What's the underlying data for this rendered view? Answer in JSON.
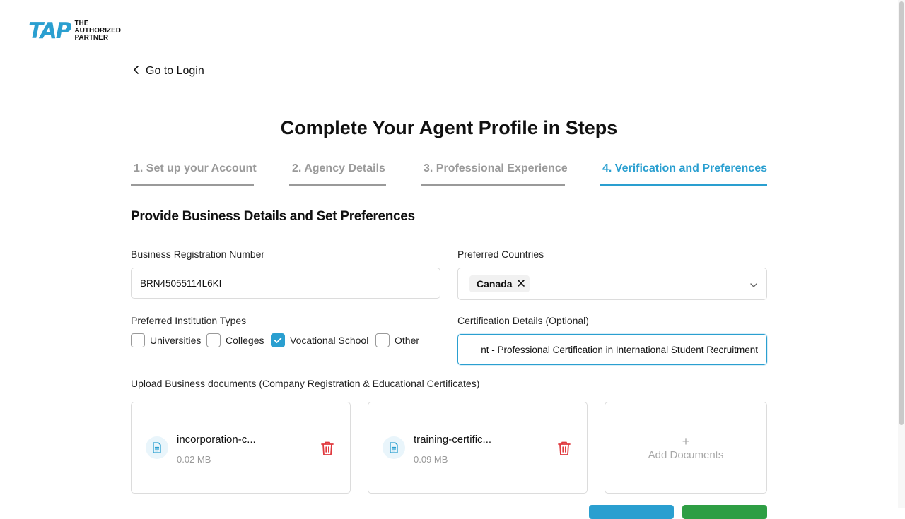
{
  "logo": {
    "mark": "TAP",
    "line1": "THE",
    "line2": "AUTHORIZED",
    "line3": "PARTNER"
  },
  "back_link": "Go to Login",
  "page_title": "Complete Your Agent Profile in Steps",
  "tabs": [
    {
      "label": "1. Set up your Account",
      "active": false
    },
    {
      "label": "2. Agency Details",
      "active": false
    },
    {
      "label": "3. Professional Experience",
      "active": false
    },
    {
      "label": "4. Verification and Preferences",
      "active": true
    }
  ],
  "section_title": "Provide Business Details and Set Preferences",
  "brn": {
    "label": "Business Registration Number",
    "value": "BRN45055114L6KI"
  },
  "countries": {
    "label": "Preferred Countries",
    "selected": [
      "Canada"
    ]
  },
  "institution_types": {
    "label": "Preferred Institution Types",
    "options": [
      {
        "label": "Universities",
        "checked": false
      },
      {
        "label": "Colleges",
        "checked": false
      },
      {
        "label": "Vocational School",
        "checked": true
      },
      {
        "label": "Other",
        "checked": false
      }
    ]
  },
  "certification": {
    "label": "Certification Details (Optional)",
    "value": "nt - Professional Certification in International Student Recruitment"
  },
  "upload": {
    "label": "Upload Business documents (Company Registration & Educational Certificates)",
    "files": [
      {
        "name": "incorporation-c...",
        "size": "0.02 MB"
      },
      {
        "name": "training-certific...",
        "size": "0.09 MB"
      }
    ],
    "add_plus": "+",
    "add_label": "Add Documents"
  },
  "colors": {
    "accent": "#2a9fd0",
    "muted": "#9a9a9a",
    "danger": "#e0393e",
    "success": "#2e9e44"
  }
}
